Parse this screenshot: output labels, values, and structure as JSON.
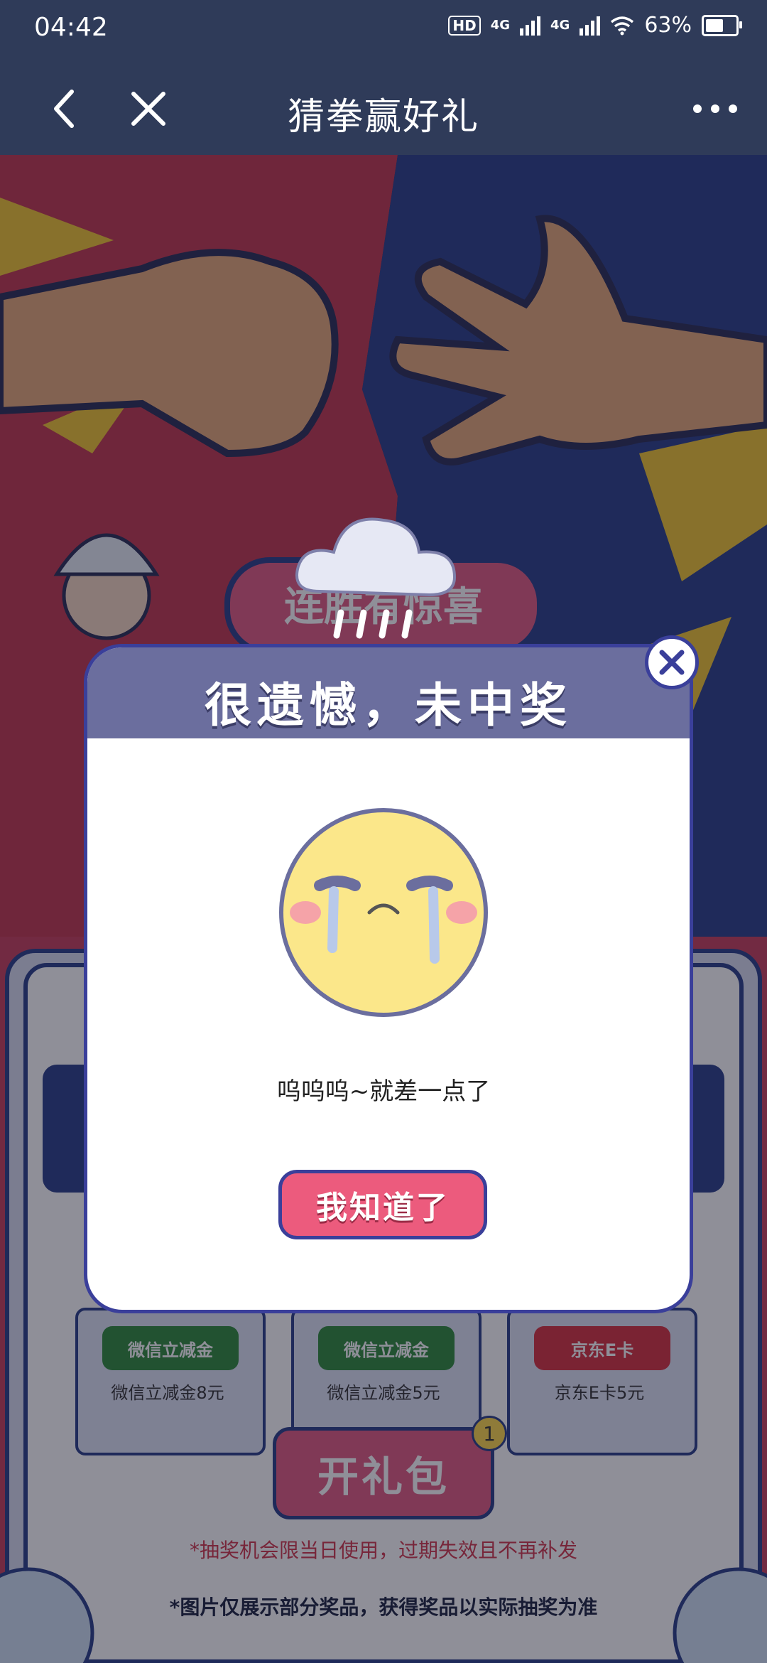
{
  "status_bar": {
    "time": "04:42",
    "hd_badge": "HD",
    "network_1": "4G",
    "network_2": "4G",
    "battery": "63%"
  },
  "nav": {
    "title": "猜拳赢好礼",
    "back_icon": "chevron-left-icon",
    "close_icon": "close-icon",
    "more_icon": "more-dots-icon"
  },
  "background_banner": "连胜有惊喜",
  "modal": {
    "title": "很遗憾，未中奖",
    "message": "呜呜呜~就差一点了",
    "button": "我知道了",
    "close_icon": "close-circle-icon",
    "header_icon": "rain-cloud-icon",
    "face_icon": "crying-face-icon"
  },
  "prizes": [
    {
      "tag": "微信立减金",
      "name": "微信立减金8元",
      "color": "#2f8a3b"
    },
    {
      "tag": "微信立减金",
      "name": "微信立减金5元",
      "color": "#2f8a3b"
    },
    {
      "tag": "京东E卡",
      "name": "京东E卡5元",
      "color": "#d6303e"
    }
  ],
  "open_button": {
    "label": "开礼包",
    "count": "1"
  },
  "notice": "*抽奖机会限当日使用，过期失效且不再补发",
  "footnote": "*图片仅展示部分奖品，获得奖品以实际抽奖为准",
  "colors": {
    "nav_bg": "#2f3b59",
    "red_panel": "#c2364d",
    "blue_panel": "#2a3f88",
    "modal_header": "#6b6e9e",
    "button_pink": "#ec5b7d"
  }
}
